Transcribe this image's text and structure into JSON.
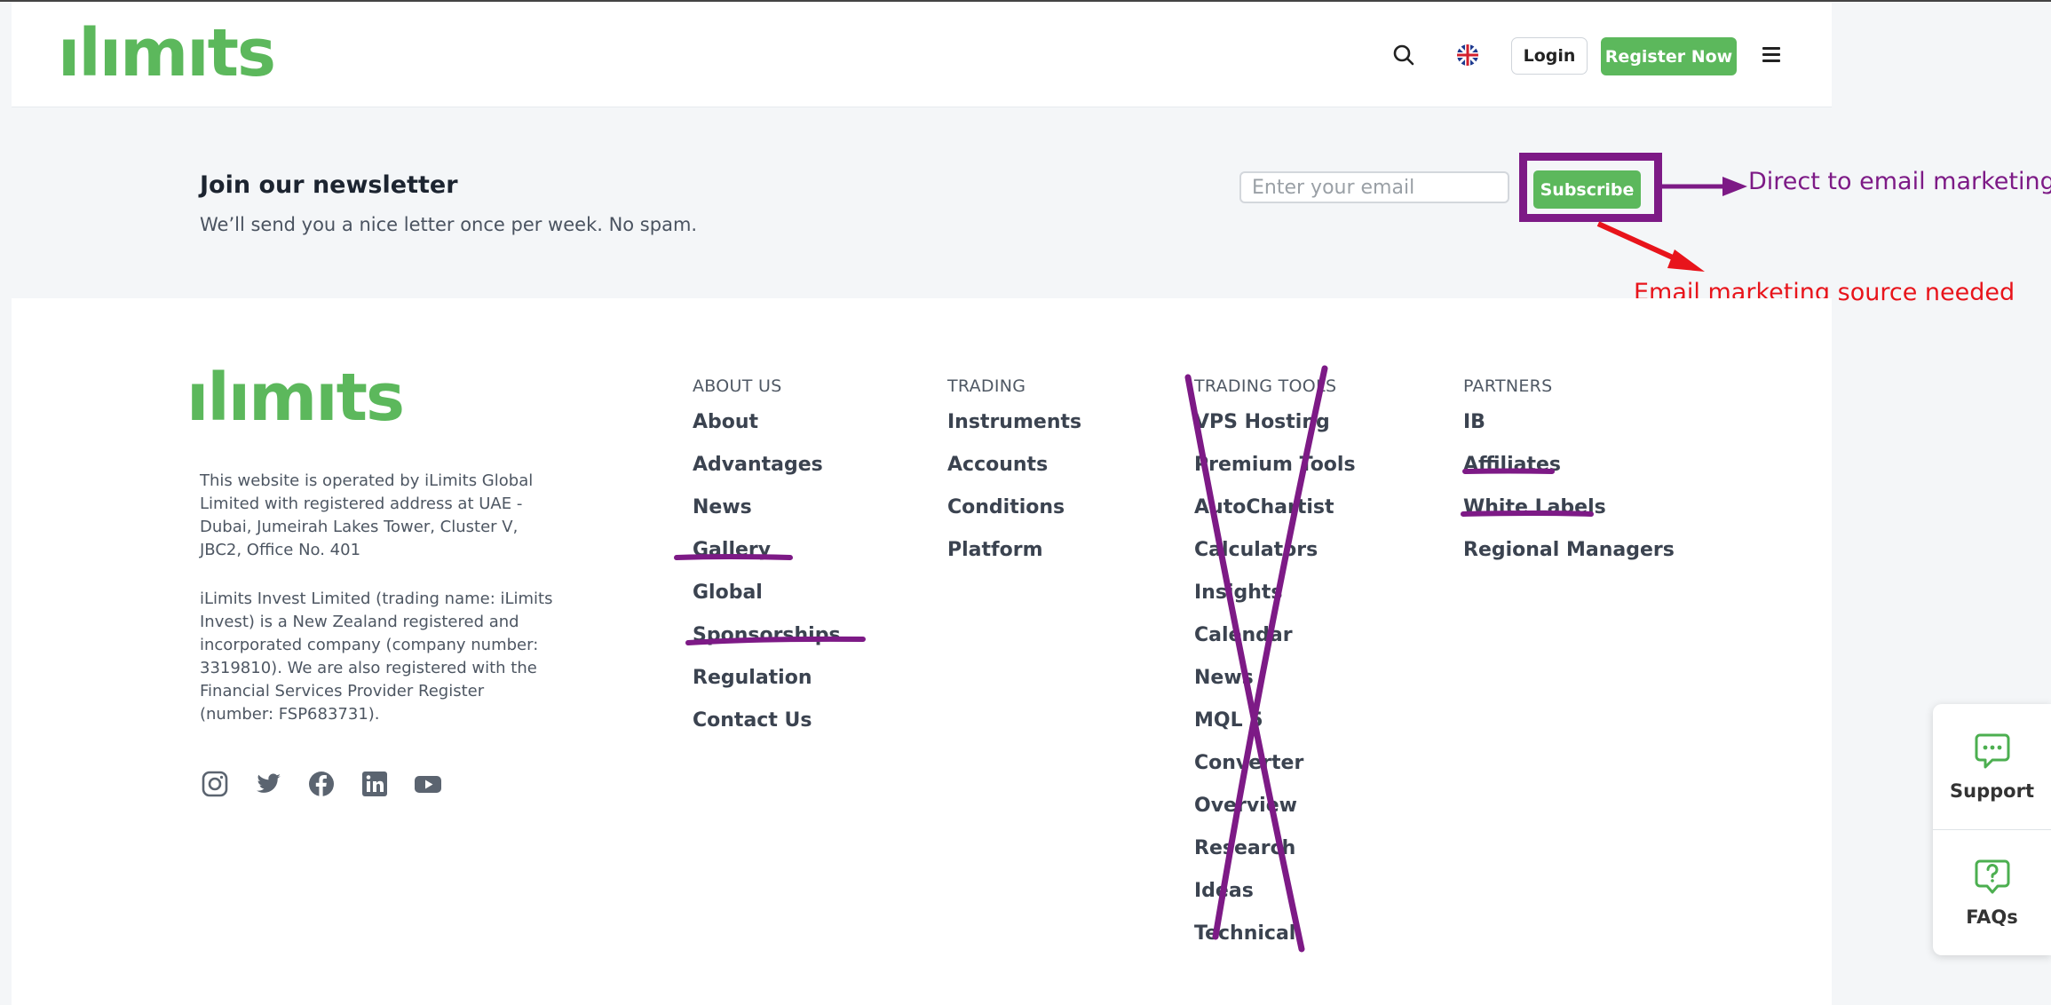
{
  "header": {
    "logo": "ılımıts",
    "login_label": "Login",
    "register_label": "Register Now"
  },
  "newsletter": {
    "title": "Join our newsletter",
    "subtitle": "We’ll send you a nice letter once per week. No spam.",
    "email_placeholder": "Enter your email",
    "subscribe_label": "Subscribe"
  },
  "annotations": {
    "direct": "Direct to email marketing",
    "source": "Email marketing source needed",
    "purple": "#7d1a86",
    "red": "#e8141b"
  },
  "footer": {
    "logo": "ılımıts",
    "legal_1": "This website is operated by iLimits Global Limited with registered address at UAE - Dubai, Jumeirah Lakes Tower, Cluster V, JBC2, Office No. 401",
    "legal_2": "iLimits Invest Limited (trading name: iLimits Invest) is a New Zealand registered and incorporated company (company number: 3319810). We are also registered with the Financial Services Provider Register (number: FSP683731).",
    "social_icons": [
      "instagram-icon",
      "twitter-icon",
      "facebook-icon",
      "linkedin-icon",
      "youtube-icon"
    ],
    "columns": [
      {
        "heading": "ABOUT US",
        "items": [
          "About",
          "Advantages",
          "News",
          "Gallery",
          "Global",
          "Sponsorships",
          "Regulation",
          "Contact Us"
        ]
      },
      {
        "heading": "TRADING",
        "items": [
          "Instruments",
          "Accounts",
          "Conditions",
          "Platform"
        ]
      },
      {
        "heading": "TRADING TOOLS",
        "items": [
          "VPS Hosting",
          "Premium Tools",
          "AutoChartist",
          "Calculators",
          "Insights",
          "Calendar",
          "News",
          "MQL 5",
          "Converter",
          "Overview",
          "Research",
          "Ideas",
          "Technical"
        ]
      },
      {
        "heading": "PARTNERS",
        "items": [
          "IB",
          "Affiliates",
          "White Labels",
          "Regional Managers"
        ]
      }
    ]
  },
  "side_widget": {
    "support_label": "Support",
    "faqs_label": "FAQs"
  },
  "colors": {
    "brand_green": "#5cb85c"
  }
}
